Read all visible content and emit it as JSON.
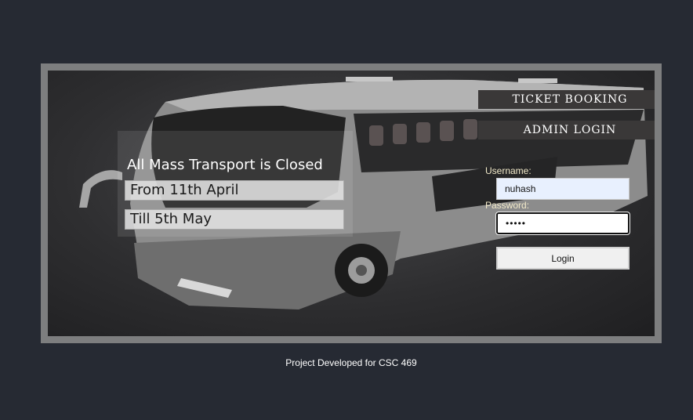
{
  "menu": {
    "ticket_booking": "TICKET BOOKING",
    "admin_login": "ADMIN LOGIN"
  },
  "notice": {
    "title": "All Mass Transport is Closed",
    "line1": "From 11th April",
    "line2": "Till 5th May"
  },
  "login": {
    "username_label": "Username:",
    "username_value": "nuhash",
    "password_label": "Password:",
    "password_value": "•••••",
    "button_label": "Login"
  },
  "footer": {
    "text": "Project Developed for CSC 469"
  }
}
